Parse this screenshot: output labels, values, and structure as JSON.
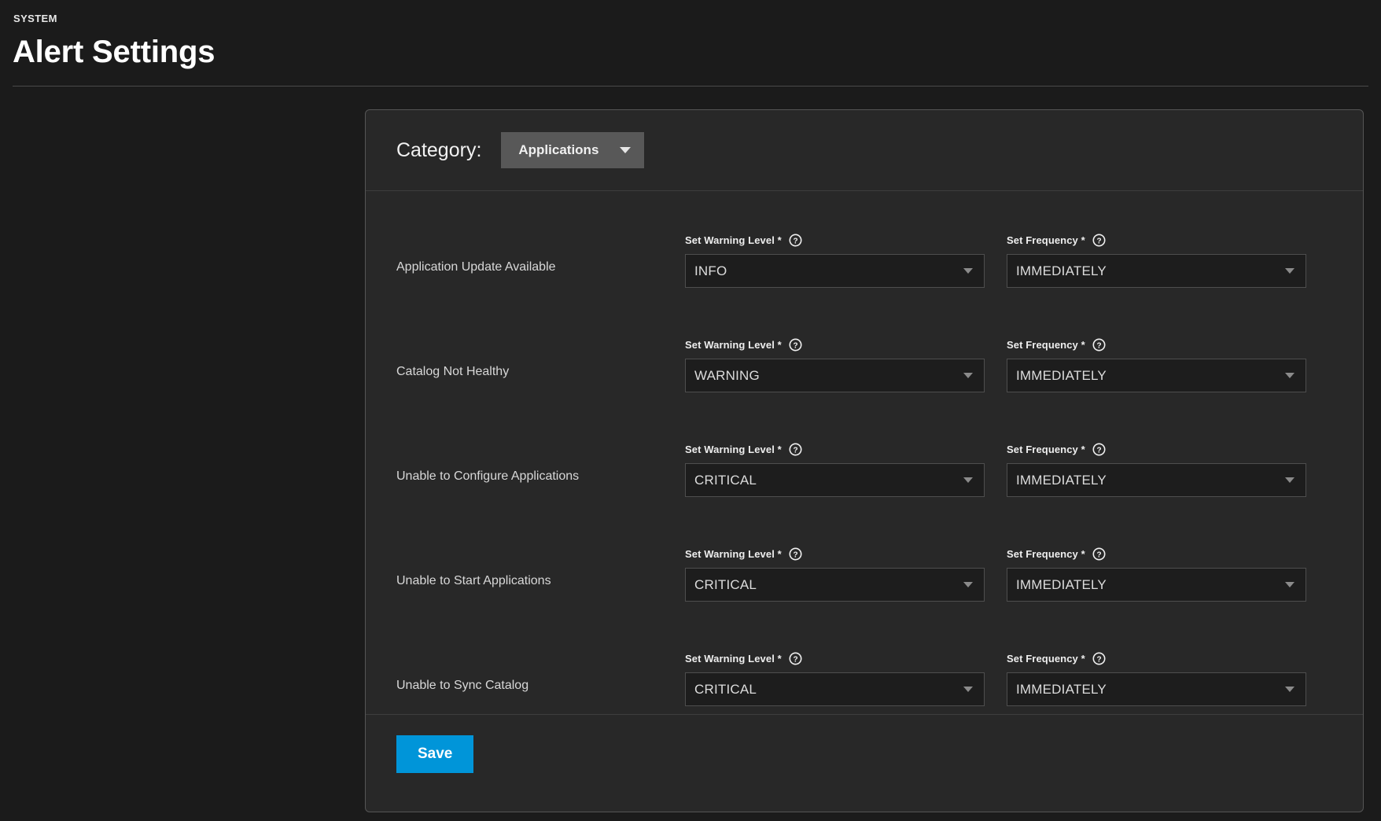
{
  "header": {
    "eyebrow": "SYSTEM",
    "title": "Alert Settings"
  },
  "category": {
    "label": "Category:",
    "selected": "Applications",
    "caret_icon": "chevron-down-icon"
  },
  "field_labels": {
    "warning_level": "Set Warning Level *",
    "frequency": "Set Frequency *",
    "help_icon": "help-circle-icon"
  },
  "rows": [
    {
      "name": "Application Update Available",
      "warning_level": "INFO",
      "frequency": "IMMEDIATELY"
    },
    {
      "name": "Catalog Not Healthy",
      "warning_level": "WARNING",
      "frequency": "IMMEDIATELY"
    },
    {
      "name": "Unable to Configure Applications",
      "warning_level": "CRITICAL",
      "frequency": "IMMEDIATELY"
    },
    {
      "name": "Unable to Start Applications",
      "warning_level": "CRITICAL",
      "frequency": "IMMEDIATELY"
    },
    {
      "name": "Unable to Sync Catalog",
      "warning_level": "CRITICAL",
      "frequency": "IMMEDIATELY"
    }
  ],
  "footer": {
    "save_label": "Save"
  },
  "colors": {
    "page_background": "#1b1b1b",
    "card_background": "#282828",
    "accent_save": "#0095d9",
    "category_chip": "#585858",
    "select_background": "#1d1d1d"
  }
}
